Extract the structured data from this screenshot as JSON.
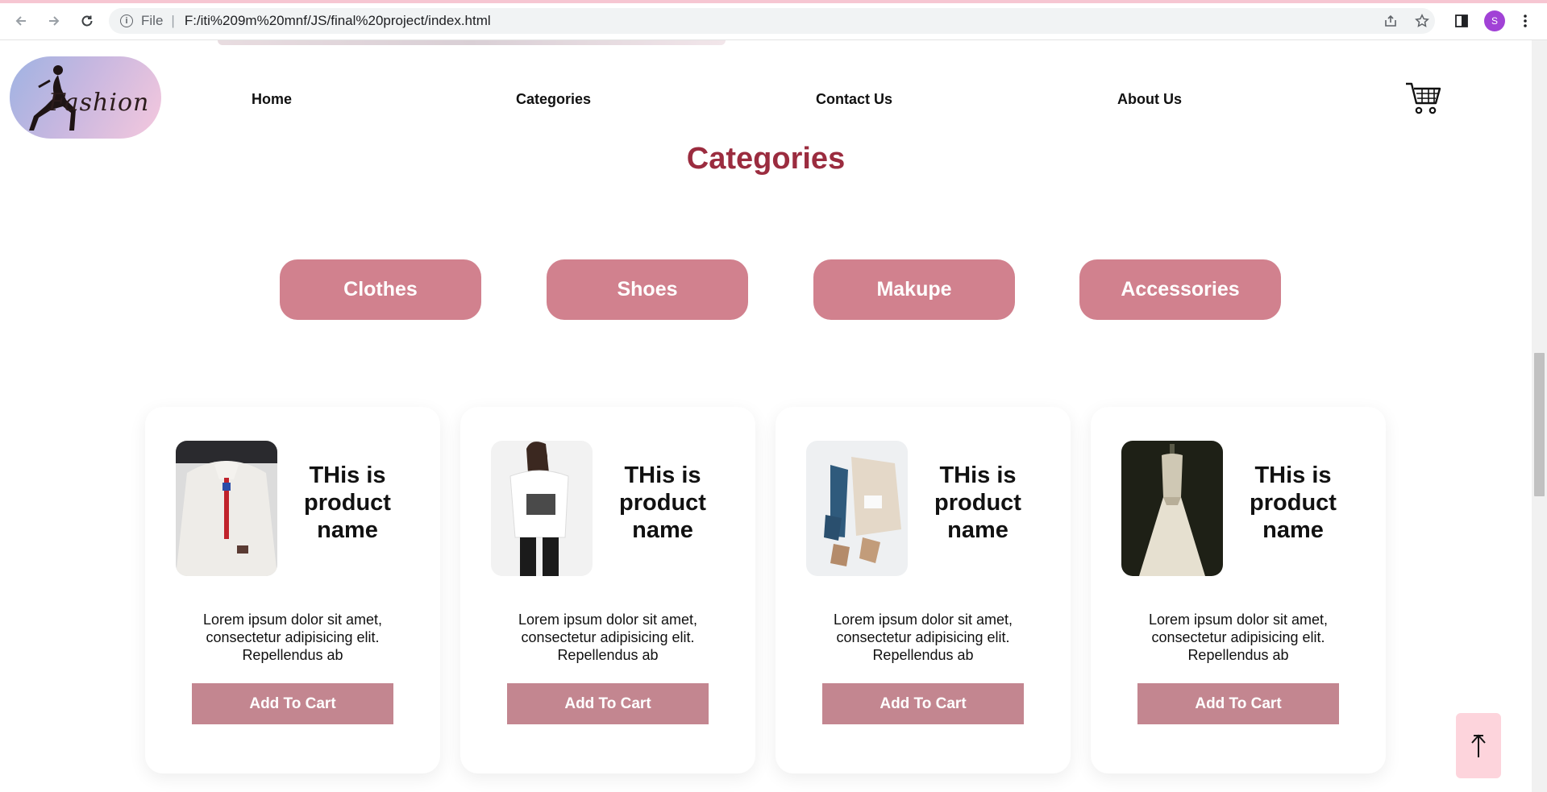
{
  "browser": {
    "scheme": "File",
    "separator": "|",
    "url": "F:/iti%209m%20mnf/JS/final%20project/index.html",
    "profile_initial": "S",
    "profile_color": "#a142d6"
  },
  "header": {
    "logo_text": "Fashion",
    "nav": [
      "Home",
      "Categories",
      "Contact Us",
      "About Us"
    ]
  },
  "categories_section": {
    "title": "Categories",
    "buttons": [
      "Clothes",
      "Shoes",
      "Makupe",
      "Accessories"
    ]
  },
  "products": [
    {
      "name": "THis is product name",
      "description": "Lorem ipsum dolor sit amet, consectetur adipisicing elit. Repellendus ab",
      "button": "Add To Cart"
    },
    {
      "name": "THis is product name",
      "description": "Lorem ipsum dolor sit amet, consectetur adipisicing elit. Repellendus ab",
      "button": "Add To Cart"
    },
    {
      "name": "THis is product name",
      "description": "Lorem ipsum dolor sit amet, consectetur adipisicing elit. Repellendus ab",
      "button": "Add To Cart"
    },
    {
      "name": "THis is product name",
      "description": "Lorem ipsum dolor sit amet, consectetur adipisicing elit. Repellendus ab",
      "button": "Add To Cart"
    }
  ],
  "colors": {
    "title": "#9b2c3f",
    "category_button": "#d1818e",
    "cart_button": "#c38690",
    "scroll_top_bg": "#fdd4dc"
  },
  "icons": {
    "cart": "shopping-cart-icon",
    "scroll_top": "arrow-up-icon"
  }
}
